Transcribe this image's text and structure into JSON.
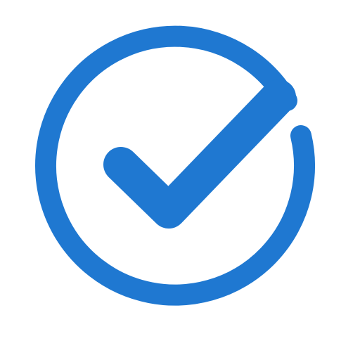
{
  "icon": {
    "name": "check-circle-icon",
    "color": "#1F78D1",
    "background": "#FFFFFF"
  }
}
